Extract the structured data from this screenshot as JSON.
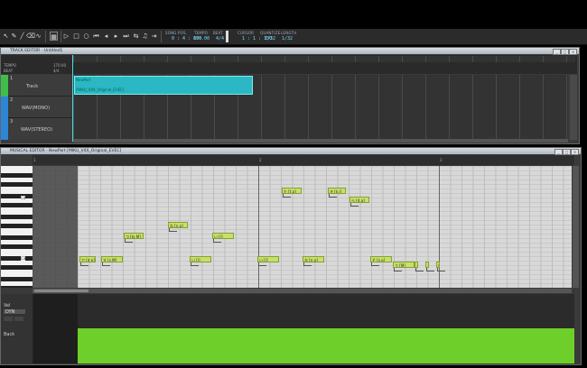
{
  "toolbar": {
    "song_pos_label": "SONG POS.",
    "song_pos_value": "0 : 4 : 000",
    "tempo_label": "TEMPO",
    "tempo_value": "170.00",
    "beat_label": "BEAT",
    "beat_value": "4/4",
    "cursor_label": "CURSOR",
    "cursor_value": "1 : 1 : 150",
    "cursor_div": "1/32",
    "quantize_label": "QUANTIZE",
    "length_label": "LENGTH",
    "quantize_value": "1/32",
    "length_value": "1/32"
  },
  "track_editor": {
    "title": "TRACK EDITOR - Untitled1",
    "tempo_label": "TEMPO",
    "beat_label": "BEAT",
    "tempo_value": "170.00",
    "beat_value": "4/4",
    "tracks": [
      {
        "num": "1",
        "name": "Track"
      },
      {
        "num": "2",
        "name": "WAV(MONO)"
      },
      {
        "num": "3",
        "name": "WAV(STEREO)"
      }
    ],
    "part_name": "NewPart",
    "part_singer": "[MIKU_V4X_Original_EVEC]",
    "part_color": "#2bb7c4"
  },
  "musical_editor": {
    "title": "MUSICAL EDITOR - NewPart [MIKU_V4X_Original_EVEC]",
    "bars": [
      "1",
      "2",
      "3"
    ],
    "key_c4": "C4",
    "key_c3": "C3",
    "notes": [
      "た [t a]",
      "き [k i]",
      "ら [4 a]",
      "つ [ts M]",
      "な [n a]",
      "い [i]",
      "で [d e]",
      "す [s M]",
      "い [i]",
      "い [i]",
      "な [n a]",
      "そ [s o]",
      "う [M]",
      "う [M]",
      "う [M]",
      "い [i]"
    ]
  },
  "control_track": {
    "value_label": "Vel",
    "mode": "DYN",
    "param_label": "Back",
    "colors": {
      "fill": "#6fcf2a"
    }
  }
}
